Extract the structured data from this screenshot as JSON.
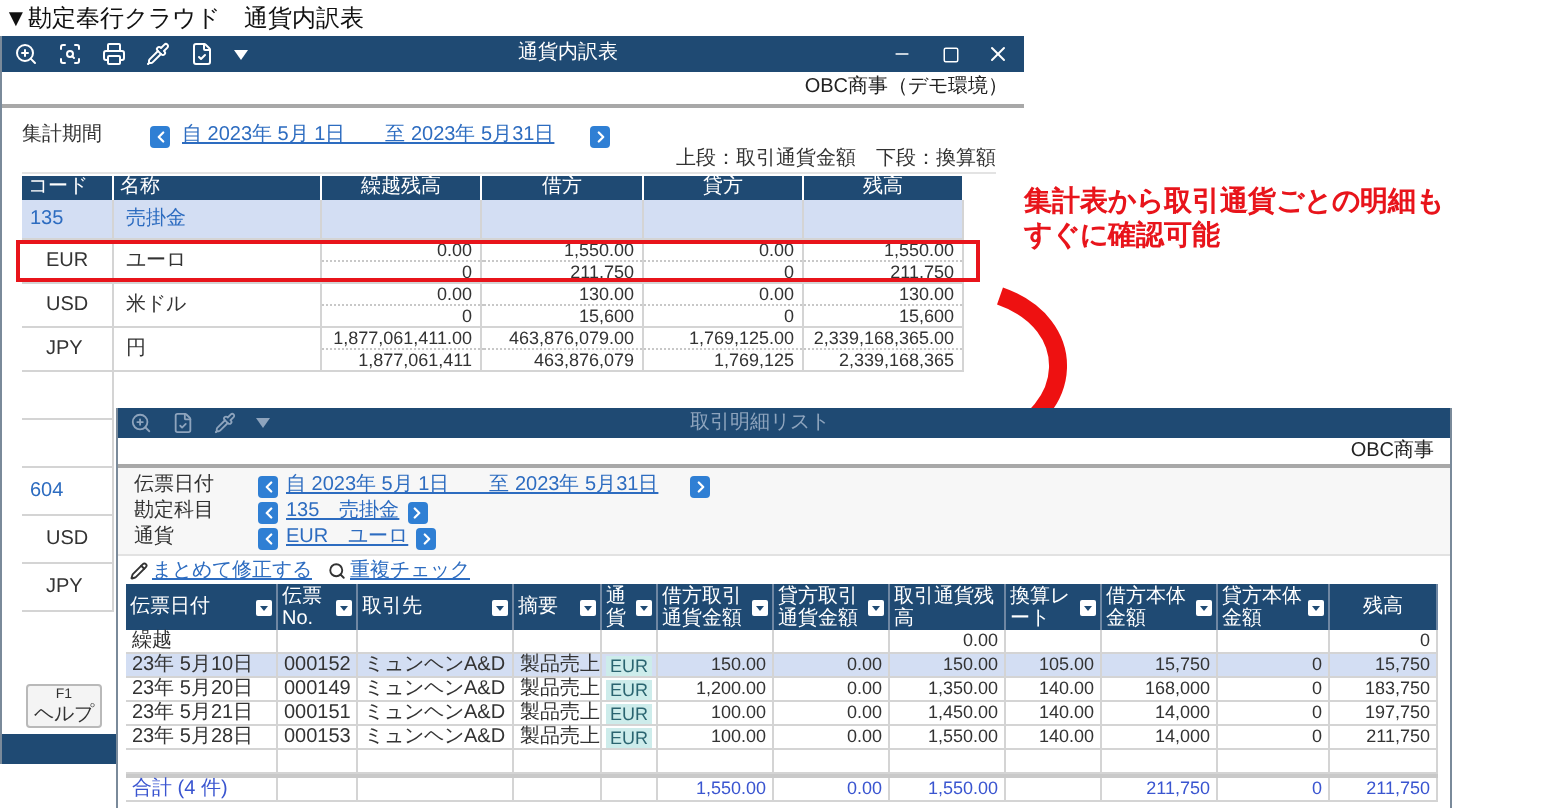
{
  "caption": "▼勘定奉行クラウド　通貨内訳表",
  "summary_window": {
    "title": "通貨内訳表",
    "company": "OBC商事（デモ環境）",
    "period": {
      "label": "集計期間",
      "range": "自 2023年 5月 1日　　至 2023年 5月31日"
    },
    "legend": "上段：取引通貨金額　下段：換算額",
    "columns": [
      "コード",
      "名称",
      "繰越残高",
      "借方",
      "貸方",
      "残高"
    ],
    "rows": [
      {
        "kind": "account",
        "code": "135",
        "name": "売掛金",
        "selected": true,
        "highlighted": false
      },
      {
        "kind": "currency",
        "code": "EUR",
        "name": "ユーロ",
        "selected": false,
        "highlighted": true,
        "amounts": [
          [
            "0.00",
            "0"
          ],
          [
            "1,550.00",
            "211,750"
          ],
          [
            "0.00",
            "0"
          ],
          [
            "1,550.00",
            "211,750"
          ]
        ]
      },
      {
        "kind": "currency",
        "code": "USD",
        "name": "米ドル",
        "selected": false,
        "highlighted": false,
        "amounts": [
          [
            "0.00",
            "0"
          ],
          [
            "130.00",
            "15,600"
          ],
          [
            "0.00",
            "0"
          ],
          [
            "130.00",
            "15,600"
          ]
        ]
      },
      {
        "kind": "currency",
        "code": "JPY",
        "name": "円",
        "selected": false,
        "highlighted": false,
        "amounts": [
          [
            "1,877,061,411.00",
            "1,877,061,411"
          ],
          [
            "463,876,079.00",
            "463,876,079"
          ],
          [
            "1,769,125.00",
            "1,769,125"
          ],
          [
            "2,339,168,365.00",
            "2,339,168,365"
          ]
        ]
      },
      {
        "kind": "blank"
      },
      {
        "kind": "blank"
      },
      {
        "kind": "account",
        "code": "604",
        "selected": false,
        "highlighted": false
      },
      {
        "kind": "currency",
        "code": "USD",
        "selected": false,
        "highlighted": false
      },
      {
        "kind": "currency",
        "code": "JPY",
        "selected": false,
        "highlighted": false
      }
    ],
    "function_keys": [
      {
        "key": "F1",
        "label": "ヘルプ"
      }
    ]
  },
  "annotation": {
    "lines": [
      "集計表から取引通貨ごとの明細も",
      "すぐに確認可能"
    ]
  },
  "detail_window": {
    "title": "取引明細リスト",
    "company": "OBC商事",
    "filters": [
      {
        "label": "伝票日付",
        "value": "自 2023年 5月 1日　　至 2023年 5月31日"
      },
      {
        "label": "勘定科目",
        "value": "135　売掛金"
      },
      {
        "label": "通貨",
        "value": "EUR　ユーロ"
      }
    ],
    "actions": [
      {
        "kind": "edit",
        "label": "まとめて修正する"
      },
      {
        "kind": "search",
        "label": "重複チェック"
      }
    ],
    "columns": [
      {
        "label": "伝票日付",
        "kind": "text",
        "filter": true
      },
      {
        "label": "伝票No.",
        "kind": "text",
        "filter": true
      },
      {
        "label": "取引先",
        "kind": "text",
        "filter": true
      },
      {
        "label": "摘要",
        "kind": "text",
        "filter": true
      },
      {
        "label": "通貨",
        "kind": "code",
        "filter": true
      },
      {
        "label": "借方取引通貨金額",
        "kind": "number",
        "filter": true
      },
      {
        "label": "貸方取引通貨金額",
        "kind": "number",
        "filter": true
      },
      {
        "label": "取引通貨残高",
        "kind": "number",
        "filter": false
      },
      {
        "label": "換算レート",
        "kind": "number",
        "filter": true
      },
      {
        "label": "借方本体金額",
        "kind": "number",
        "filter": true
      },
      {
        "label": "貸方本体金額",
        "kind": "number",
        "filter": true
      },
      {
        "label": "残高",
        "kind": "number",
        "filter": false
      }
    ],
    "rows": [
      {
        "kind": "carry",
        "selected": false,
        "cells": [
          "繰越",
          null,
          null,
          null,
          null,
          null,
          null,
          "0.00",
          null,
          null,
          null,
          "0"
        ]
      },
      {
        "kind": "entry",
        "selected": true,
        "cells": [
          "23年 5月10日",
          "000152",
          "ミュンヘンA&D",
          "製品売上",
          "EUR",
          "150.00",
          "0.00",
          "150.00",
          "105.00",
          "15,750",
          "0",
          "15,750"
        ]
      },
      {
        "kind": "entry",
        "selected": false,
        "cells": [
          "23年 5月20日",
          "000149",
          "ミュンヘンA&D",
          "製品売上",
          "EUR",
          "1,200.00",
          "0.00",
          "1,350.00",
          "140.00",
          "168,000",
          "0",
          "183,750"
        ]
      },
      {
        "kind": "entry",
        "selected": false,
        "cells": [
          "23年 5月21日",
          "000151",
          "ミュンヘンA&D",
          "製品売上",
          "EUR",
          "100.00",
          "0.00",
          "1,450.00",
          "140.00",
          "14,000",
          "0",
          "197,750"
        ]
      },
      {
        "kind": "entry",
        "selected": false,
        "cells": [
          "23年 5月28日",
          "000153",
          "ミュンヘンA&D",
          "製品売上",
          "EUR",
          "100.00",
          "0.00",
          "1,550.00",
          "140.00",
          "14,000",
          "0",
          "211,750"
        ]
      },
      {
        "kind": "blank"
      },
      {
        "kind": "total",
        "selected": false,
        "cells": [
          "合計 (4 件)",
          null,
          null,
          null,
          null,
          "1,550.00",
          "0.00",
          "1,550.00",
          null,
          "211,750",
          "0",
          "211,750"
        ]
      }
    ]
  }
}
